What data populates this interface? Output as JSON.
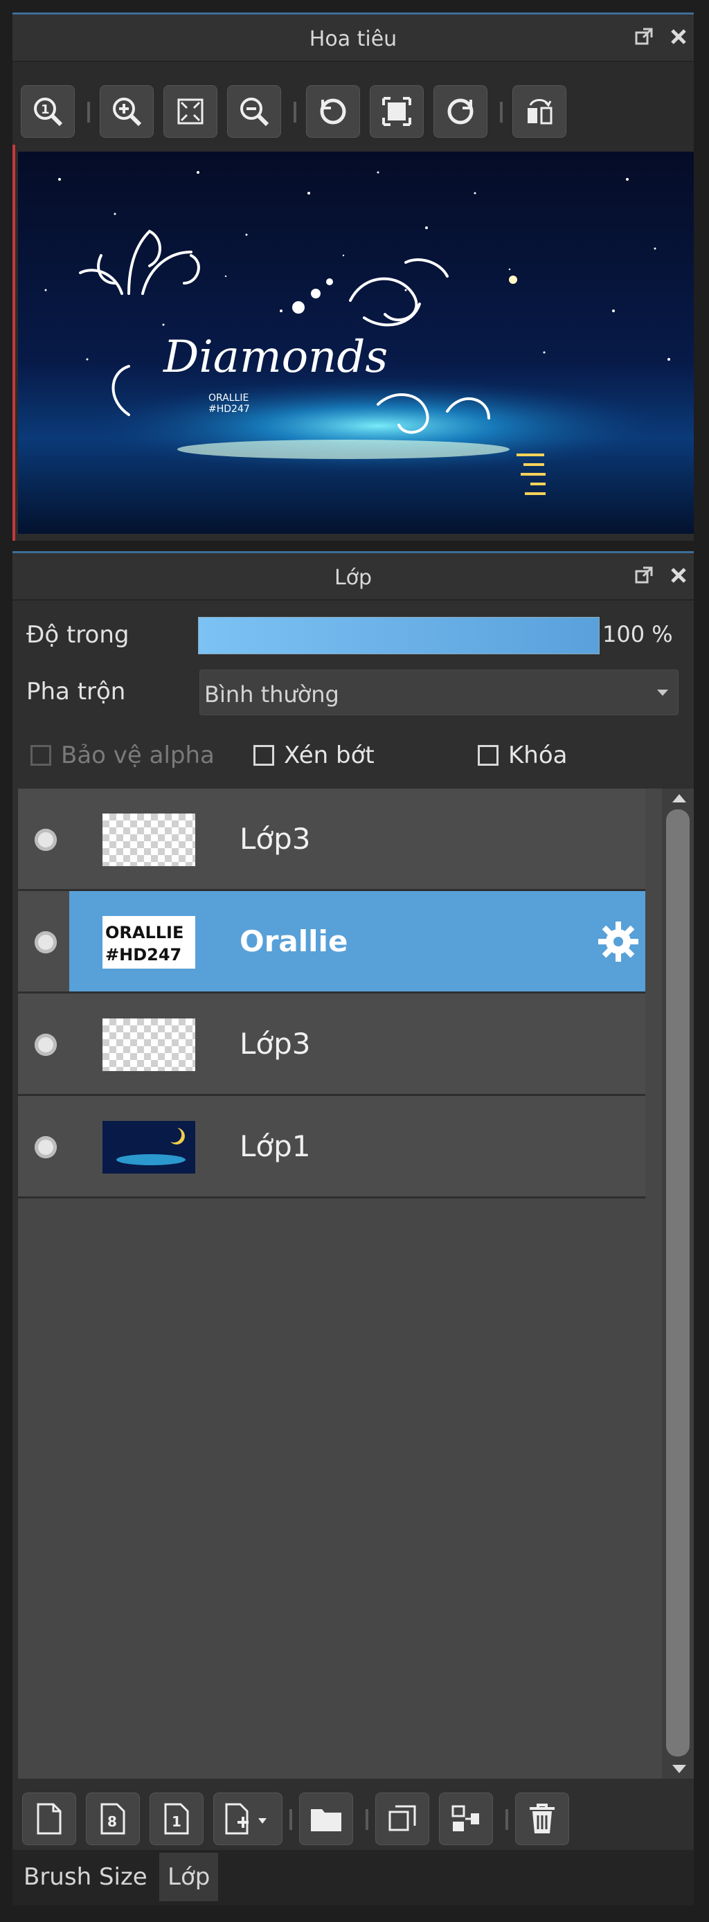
{
  "navigator": {
    "title": "Hoa tiêu",
    "toolbar": [
      {
        "icon": "zoom-actual-icon"
      },
      {
        "icon": "zoom-in-icon"
      },
      {
        "icon": "fit-window-icon"
      },
      {
        "icon": "zoom-out-icon"
      },
      {
        "icon": "rotate-left-icon"
      },
      {
        "icon": "fit-screen-icon"
      },
      {
        "icon": "rotate-right-icon"
      },
      {
        "icon": "flip-horizontal-icon"
      }
    ],
    "preview": {
      "art_title": "Diamonds",
      "art_sub1": "ORALLIE",
      "art_sub2": "#HD247"
    }
  },
  "layers_panel": {
    "title": "Lớp",
    "opacity_label": "Độ trong",
    "opacity_value": "100 %",
    "opacity_fraction": 1.0,
    "blend_label": "Pha trộn",
    "blend_value": "Bình thường",
    "protect_alpha": "Bảo vệ alpha",
    "clipping": "Xén bớt",
    "lock": "Khóa",
    "layers": [
      {
        "name": "Lớp3",
        "thumb": "transparent",
        "selected": false
      },
      {
        "name": "Orallie",
        "thumb": "text",
        "thumb_line1": "ORALLIE",
        "thumb_line2": "#HD247",
        "selected": true
      },
      {
        "name": "Lớp3",
        "thumb": "transparent",
        "selected": false
      },
      {
        "name": "Lớp1",
        "thumb": "night",
        "selected": false
      }
    ],
    "bottom_toolbar": [
      {
        "icon": "new-layer-icon"
      },
      {
        "icon": "new-8bit-layer-icon"
      },
      {
        "icon": "new-1bit-layer-icon"
      },
      {
        "icon": "add-layer-menu-icon"
      },
      {
        "icon": "folder-icon"
      },
      {
        "icon": "duplicate-layer-icon"
      },
      {
        "icon": "merge-down-icon"
      },
      {
        "icon": "delete-layer-icon"
      }
    ]
  },
  "tabs": [
    {
      "label": "Brush Size",
      "active": false
    },
    {
      "label": "Lớp",
      "active": true
    }
  ],
  "colors": {
    "accent": "#58a0d8",
    "panel": "#2f2f2f",
    "opacity_bar": "#6cb4ec",
    "scene_dark": "#061334",
    "moon": "#f1cf4a"
  }
}
